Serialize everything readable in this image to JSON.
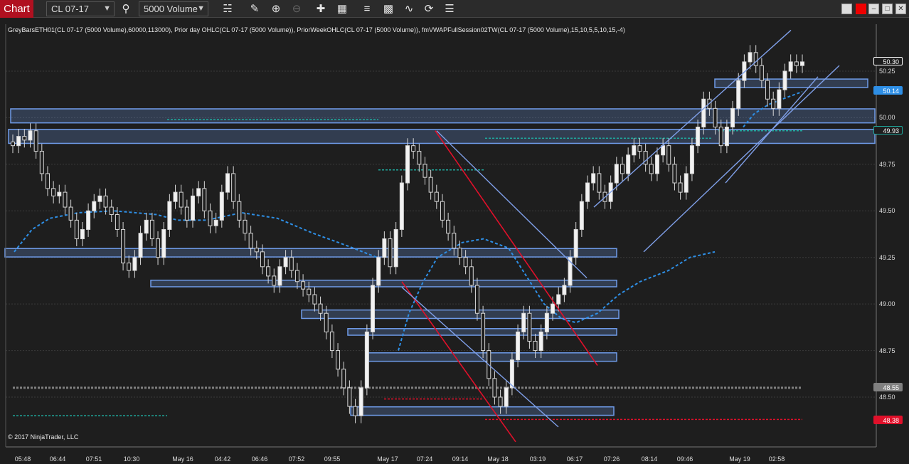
{
  "toolbar": {
    "tab_label": "Chart",
    "instrument": "CL 07-17",
    "bar_type": "5000 Volume",
    "icons": [
      "bar-style-icon",
      "draw-tool-icon",
      "zoom-in-icon",
      "zoom-out-icon",
      "crosshair-icon",
      "data-box-icon",
      "indicators-icon",
      "strategies-icon",
      "drawing-objects-icon",
      "reload-icon",
      "properties-icon"
    ]
  },
  "chart": {
    "indicator_text": "GreyBarsETH01(CL 07-17 (5000 Volume),60000,113000), Prior day OHLC(CL 07-17 (5000 Volume)), PriorWeekOHLC(CL 07-17 (5000 Volume)), fmVWAPFullSession02TW(CL 07-17 (5000 Volume),15,10,5,5,10,15,-4)",
    "copyright": "© 2017 NinjaTrader, LLC",
    "colors": {
      "background": "#1e1e1e",
      "zone_border": "#6f9be8",
      "vwap": "#2e8fe6",
      "prior_close": "#1fa89c",
      "prior_low": "#e0102a",
      "prior_mid": "#808080",
      "trend_red": "#e0102a",
      "channel": "#7f9fe8"
    }
  },
  "price_axis": {
    "labels": [
      "50.25",
      "50.00",
      "49.75",
      "49.50",
      "49.25",
      "49.00",
      "48.75",
      "48.50"
    ],
    "tags": [
      {
        "text": "50.30",
        "bg": "#1e1e1e",
        "fg": "#ffffff",
        "border": "#ffffff"
      },
      {
        "text": "50.14",
        "bg": "#2e8fe6",
        "fg": "#ffffff",
        "border": "#2e8fe6"
      },
      {
        "text": "49.93",
        "bg": "#1e1e1e",
        "fg": "#ffffff",
        "border": "#1fa89c"
      },
      {
        "text": "48.55",
        "bg": "#808080",
        "fg": "#ffffff",
        "border": "#808080"
      },
      {
        "text": "48.38",
        "bg": "#e0102a",
        "fg": "#ffffff",
        "border": "#e0102a"
      }
    ]
  },
  "time_axis": {
    "labels": [
      "05:48",
      "06:44",
      "07:51",
      "10:30",
      "May 16",
      "04:42",
      "06:46",
      "07:52",
      "09:55",
      "May 17",
      "07:24",
      "09:14",
      "May 18",
      "03:19",
      "06:17",
      "07:26",
      "08:14",
      "09:46",
      "May 19",
      "02:58"
    ]
  },
  "chart_data": {
    "type": "candlestick",
    "ylim": [
      48.28,
      50.47
    ],
    "yticks": [
      48.5,
      48.75,
      49.0,
      49.25,
      49.5,
      49.75,
      50.0,
      50.25
    ],
    "last_price": 50.3,
    "vwap_value": 50.14,
    "prior_close": 49.93,
    "prior_mid": 48.55,
    "prior_low": 48.38,
    "resistance_support_zones": [
      {
        "from": 49.98,
        "to": 50.04
      },
      {
        "from": 49.87,
        "to": 49.93
      },
      {
        "from": 50.17,
        "to": 50.2
      },
      {
        "from": 49.26,
        "to": 49.29
      },
      {
        "from": 49.1,
        "to": 49.12
      },
      {
        "from": 48.93,
        "to": 48.96
      },
      {
        "from": 48.84,
        "to": 48.86
      },
      {
        "from": 48.7,
        "to": 48.73
      },
      {
        "from": 48.41,
        "to": 48.44
      }
    ],
    "closes": [
      49.85,
      49.9,
      49.88,
      49.93,
      49.82,
      49.7,
      49.62,
      49.58,
      49.6,
      49.52,
      49.45,
      49.35,
      49.4,
      49.5,
      49.55,
      49.58,
      49.52,
      49.48,
      49.4,
      49.22,
      49.18,
      49.25,
      49.38,
      49.45,
      49.35,
      49.25,
      49.4,
      49.55,
      49.6,
      49.52,
      49.45,
      49.58,
      49.62,
      49.5,
      49.42,
      49.45,
      49.6,
      49.7,
      49.55,
      49.45,
      49.38,
      49.3,
      49.28,
      49.2,
      49.15,
      49.1,
      49.2,
      49.25,
      49.18,
      49.12,
      49.08,
      49.05,
      49.0,
      48.95,
      48.85,
      48.75,
      48.65,
      48.55,
      48.45,
      48.4,
      48.55,
      48.85,
      49.1,
      49.25,
      49.35,
      49.2,
      49.4,
      49.65,
      49.85,
      49.82,
      49.75,
      49.68,
      49.6,
      49.55,
      49.45,
      49.38,
      49.3,
      49.25,
      49.2,
      49.1,
      48.95,
      48.75,
      48.6,
      48.5,
      48.45,
      48.55,
      48.7,
      48.85,
      48.95,
      48.8,
      48.75,
      48.85,
      48.95,
      49.0,
      49.05,
      49.1,
      49.25,
      49.4,
      49.55,
      49.65,
      49.7,
      49.6,
      49.55,
      49.65,
      49.75,
      49.7,
      49.8,
      49.85,
      49.82,
      49.75,
      49.7,
      49.8,
      49.85,
      49.75,
      49.65,
      49.6,
      49.7,
      49.85,
      49.95,
      50.1,
      50.05,
      49.95,
      49.85,
      49.95,
      50.05,
      50.2,
      50.3,
      50.35,
      50.28,
      50.2,
      50.1,
      50.05,
      50.15,
      50.25,
      50.3,
      50.28,
      50.3
    ]
  }
}
